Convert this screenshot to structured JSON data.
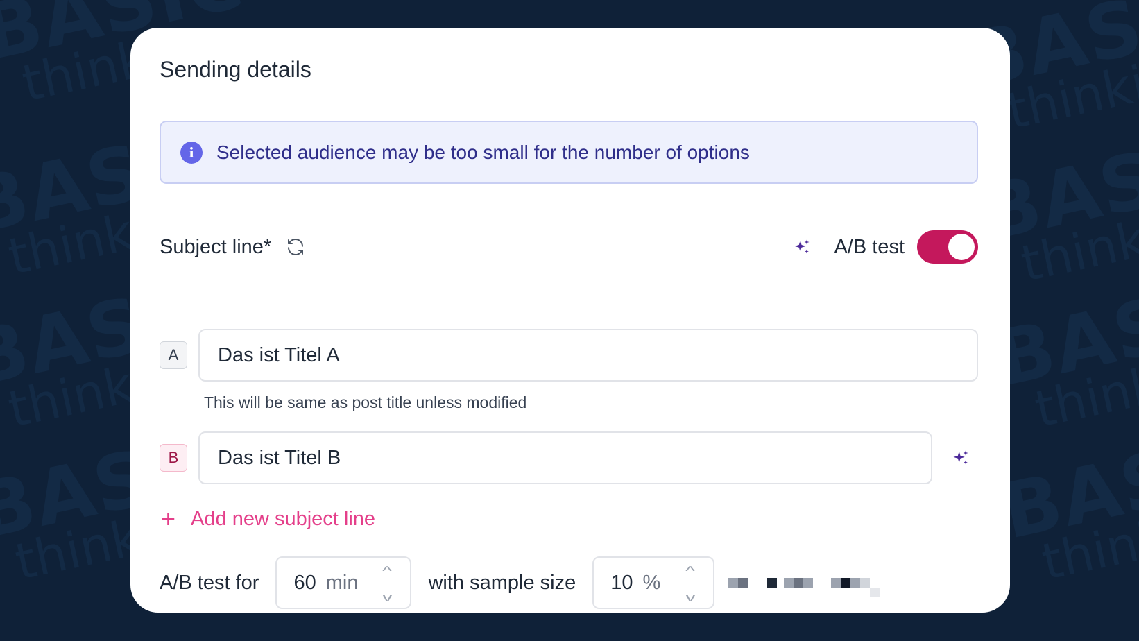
{
  "background": {
    "watermark_line1": "BASIC",
    "watermark_line2": "thinking"
  },
  "card": {
    "title": "Sending details",
    "alert": {
      "icon": "info-icon",
      "text": "Selected audience may be too small for the number of options"
    },
    "subject": {
      "label": "Subject line*",
      "refresh_icon": "refresh-icon",
      "ai_icon": "sparkle-icon",
      "ab_label": "A/B test",
      "ab_enabled": true
    },
    "variants": [
      {
        "badge": "A",
        "value": "Das ist Titel A"
      },
      {
        "badge": "B",
        "value": "Das ist Titel B"
      }
    ],
    "hint": "This will be same as post title unless modified",
    "add_line": {
      "icon": "plus-icon",
      "label": "Add new subject line"
    },
    "test": {
      "label": "A/B test for",
      "duration_value": "60",
      "duration_unit": "min",
      "sample_label": "with sample size",
      "sample_value": "10",
      "sample_unit": "%"
    }
  },
  "colors": {
    "background": "#0f2138",
    "accent_pink": "#c4185c",
    "link_pink": "#e43f8a",
    "info_purple": "#6466e8",
    "alert_text": "#2f2e8a"
  }
}
